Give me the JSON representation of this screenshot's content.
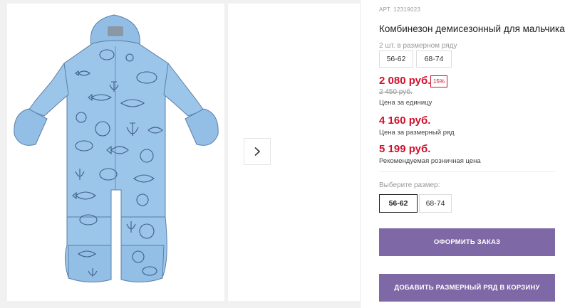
{
  "product": {
    "sku": "АРТ. 12319023",
    "title": "Комбинезон демисезонный для мальчика",
    "pack_label": "2 шт. в размерном ряду",
    "pack_sizes": [
      "56-62",
      "68-74"
    ],
    "price_unit": "2 080 руб.",
    "discount": "15%",
    "old_price": "2 450 руб.",
    "price_unit_caption": "Цена за единицу",
    "price_pack": "4 160 руб.",
    "price_pack_caption": "Цена за размерный ряд",
    "price_rrp": "5 199 руб.",
    "price_rrp_caption": "Рекомендуемая розничная цена",
    "choose_size_label": "Выберите размер:",
    "sizes": [
      "56-62",
      "68-74"
    ],
    "selected_size": "56-62"
  },
  "actions": {
    "checkout": "ОФОРМИТЬ ЗАКАЗ",
    "add_to_cart": "ДОБАВИТЬ РАЗМЕРНЫЙ РЯД В КОРЗИНУ"
  },
  "colors": {
    "accent": "#7f68a6",
    "price": "#d0102b",
    "garment": "#9cc5ea",
    "garment_pattern": "#2f4d78"
  },
  "icons": {
    "next": "chevron-right-icon"
  }
}
